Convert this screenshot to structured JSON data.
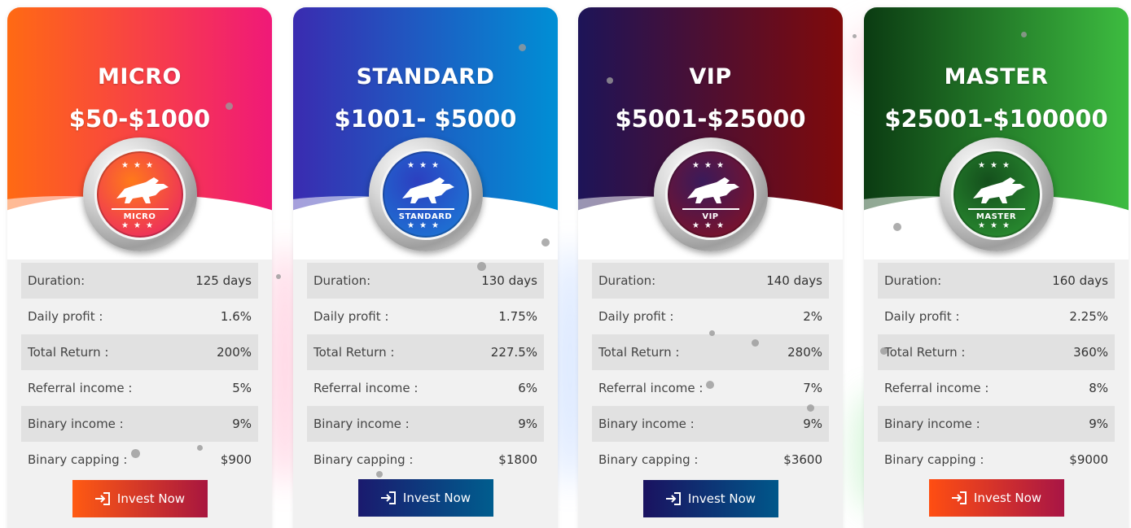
{
  "plans": [
    {
      "name": "MICRO",
      "range": "$50-$1000",
      "badge_label": "MICRO",
      "colors": {
        "grad_from": "#ff6a13",
        "grad_to": "#f01978",
        "badge_from": "#ff7a1a",
        "badge_to": "#e81a6e",
        "button_from": "#ff5a12",
        "button_to": "#a8163f"
      },
      "details": [
        {
          "label": "Duration:",
          "value": "125 days"
        },
        {
          "label": "Daily profit :",
          "value": "1.6%"
        },
        {
          "label": "Total Return :",
          "value": "200%"
        },
        {
          "label": "Referral income :",
          "value": "5%"
        },
        {
          "label": "Binary income :",
          "value": "9%"
        },
        {
          "label": "Binary capping :",
          "value": "$900"
        }
      ],
      "invest_label": "Invest Now"
    },
    {
      "name": "STANDARD",
      "range": "$1001- $5000",
      "badge_label": "STANDARD",
      "colors": {
        "grad_from": "#3a2bb0",
        "grad_to": "#008fd5",
        "badge_from": "#2c3fc0",
        "badge_to": "#1a7fd8",
        "button_from": "#1a1a6e",
        "button_to": "#005d8e"
      },
      "details": [
        {
          "label": "Duration:",
          "value": "130 days"
        },
        {
          "label": "Daily profit :",
          "value": "1.75%"
        },
        {
          "label": "Total Return :",
          "value": "227.5%"
        },
        {
          "label": "Referral income :",
          "value": "6%"
        },
        {
          "label": "Binary income :",
          "value": "9%"
        },
        {
          "label": "Binary capping :",
          "value": "$1800"
        }
      ],
      "invest_label": "Invest Now"
    },
    {
      "name": "VIP",
      "range": "$5001-$25000",
      "badge_label": "VIP",
      "colors": {
        "grad_from": "#1d1458",
        "grad_to": "#800a0a",
        "badge_from": "#3a1a5a",
        "badge_to": "#8a1020",
        "button_from": "#1a1260",
        "button_to": "#00578a"
      },
      "details": [
        {
          "label": "Duration:",
          "value": "140 days"
        },
        {
          "label": "Daily profit :",
          "value": "2%"
        },
        {
          "label": "Total Return :",
          "value": "280%"
        },
        {
          "label": "Referral income :",
          "value": "7%"
        },
        {
          "label": "Binary income :",
          "value": "9%"
        },
        {
          "label": "Binary capping :",
          "value": "$3600"
        }
      ],
      "invest_label": "Invest Now"
    },
    {
      "name": "MASTER",
      "range": "$25001-$100000",
      "badge_label": "MASTER",
      "colors": {
        "grad_from": "#0b3b12",
        "grad_to": "#3dbc40",
        "badge_from": "#144f1c",
        "badge_to": "#2e9a35",
        "button_from": "#ff4e12",
        "button_to": "#a81545"
      },
      "details": [
        {
          "label": "Duration:",
          "value": "160 days"
        },
        {
          "label": "Daily profit :",
          "value": "2.25%"
        },
        {
          "label": "Total Return :",
          "value": "360%"
        },
        {
          "label": "Referral income :",
          "value": "8%"
        },
        {
          "label": "Binary income :",
          "value": "9%"
        },
        {
          "label": "Binary capping :",
          "value": "$9000"
        }
      ],
      "invest_label": "Invest Now"
    }
  ],
  "icons": {
    "invest": "sign-in-icon",
    "badge": "bull-icon"
  }
}
